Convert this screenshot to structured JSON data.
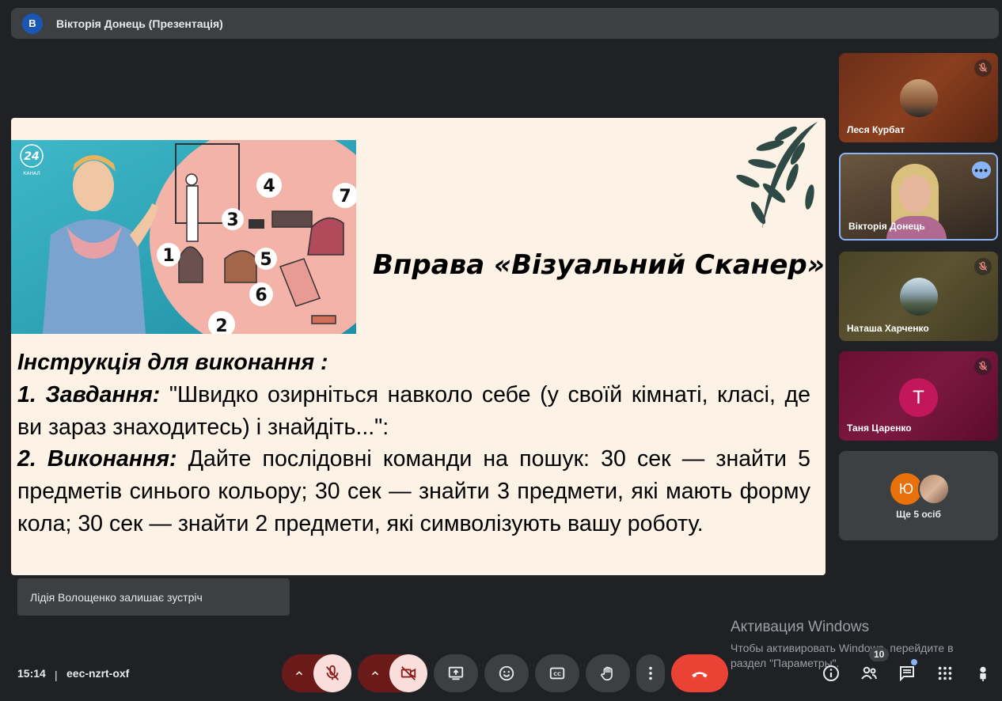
{
  "presenter": {
    "initial": "В",
    "title": "Вікторія Донець (Презентація)"
  },
  "slide": {
    "logo_text": "24",
    "logo_sub": "КАНАЛ",
    "numbers": [
      "4",
      "7",
      "3",
      "1",
      "5",
      "6",
      "2"
    ],
    "heading": "Вправа «Візуальний Сканер»",
    "instr_label": "Інструкція для виконання :",
    "step1_label": "1. Завдання:",
    "step1_text": " \"Швидко озирніться навколо себе (у своїй кімнаті, класі, де ви зараз знаходитесь) і знайдіть...\":",
    "step2_label": "2. Виконання:",
    "step2_text": " Дайте послідовні команди на пошук: 30 сек — знайти 5 предметів синього кольору; 30 сек — знайти 3 предмети, які мають форму кола; 30 сек — знайти 2 предмети, які символізують вашу роботу."
  },
  "notification": "Лідія Волощенко залишає зустріч",
  "participants": [
    {
      "name": "Леся Курбат",
      "muted": true
    },
    {
      "name": "Вікторія Донець",
      "muted": false,
      "active_speaker": true
    },
    {
      "name": "Наташа Харченко",
      "muted": true
    },
    {
      "name": "Таня Царенко",
      "initial": "Т",
      "muted": true
    }
  ],
  "more_tile": {
    "initial": "Ю",
    "label": "Ще 5 осіб"
  },
  "watermark": {
    "line1": "Активация Windows",
    "line2": "Чтобы активировать Windows, перейдите в",
    "line3": "раздел \"Параметры\"."
  },
  "bottom": {
    "time": "15:14",
    "separator": "|",
    "meeting_code": "eec-nzrt-oxf",
    "people_count": "10"
  },
  "colors": {
    "background": "#202124",
    "slide_bg": "#fdf2e6",
    "end_call": "#ea4335",
    "muted_bg": "#f9dedc",
    "accent": "#8ab4f8"
  }
}
